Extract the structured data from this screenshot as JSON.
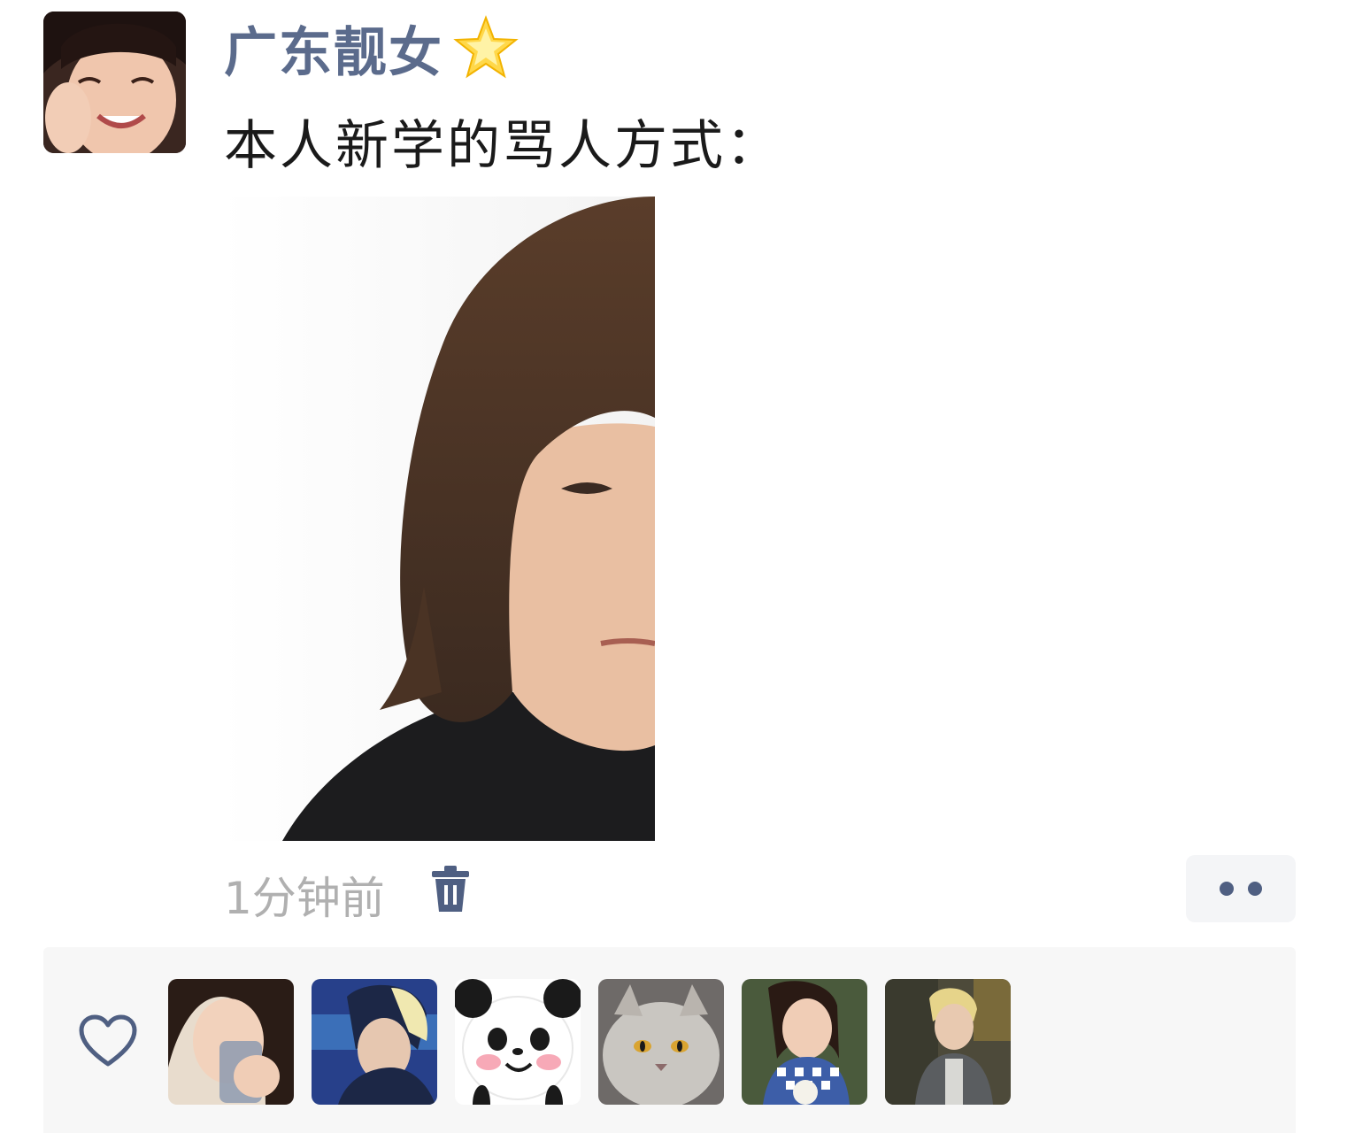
{
  "post": {
    "username": "广东靓女",
    "text": "本人新学的骂人方式：",
    "timestamp": "1分钟前"
  },
  "icons": {
    "badge": "star-icon",
    "delete": "trash-icon",
    "more": "more-dots-icon",
    "like": "heart-icon"
  },
  "colors": {
    "username": "#5b6b8c",
    "timestamp": "#b0b0b0",
    "icon_accent": "#4f5f82",
    "panel_bg": "#f7f7f7"
  },
  "likes": {
    "avatars": [
      "liker-avatar-1",
      "liker-avatar-2",
      "liker-avatar-3",
      "liker-avatar-4",
      "liker-avatar-5",
      "liker-avatar-6"
    ]
  }
}
